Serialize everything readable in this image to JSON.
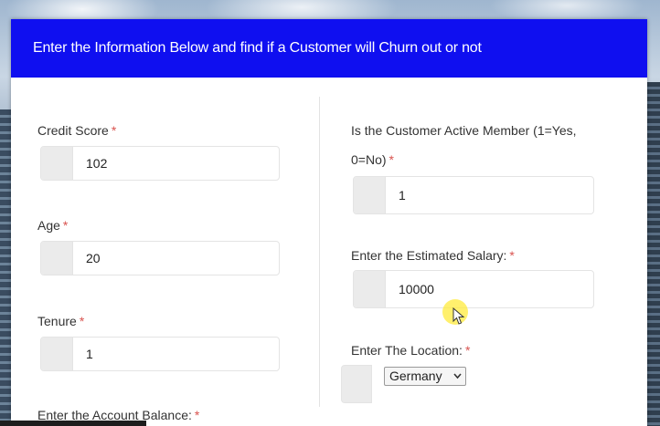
{
  "header": {
    "title": "Enter the Information Below and find if a Customer will Churn out or not"
  },
  "required_marker": "*",
  "left_column": {
    "credit_score": {
      "label": "Credit Score",
      "value": "102"
    },
    "age": {
      "label": "Age",
      "value": "20"
    },
    "tenure": {
      "label": "Tenure",
      "value": "1"
    },
    "account_balance": {
      "label": "Enter the Account Balance:"
    }
  },
  "right_column": {
    "active_member": {
      "label_line1": "Is the Customer Active Member (1=Yes,",
      "label_line2": "0=No)",
      "value": "1"
    },
    "estimated_salary": {
      "label": "Enter the Estimated Salary:",
      "value": "10000"
    },
    "location": {
      "label": "Enter The Location:",
      "selected": "Germany"
    }
  },
  "colors": {
    "header_bg": "#0f0ff0",
    "required": "#d9534f",
    "cursor_highlight": "#ffeb3c"
  },
  "icons": {
    "dropdown": "chevron-down-icon",
    "cursor": "mouse-pointer-icon"
  }
}
